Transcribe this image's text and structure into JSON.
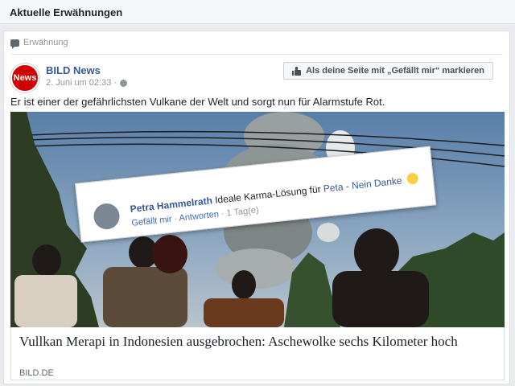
{
  "section": {
    "title": "Aktuelle Erwähnungen"
  },
  "post": {
    "mention_label": "Erwähnung",
    "page_name": "BILD News",
    "avatar_text": "News",
    "timestamp": "2. Juni um 02:33 ·",
    "like_button_label": "Als deine Seite mit „Gefällt mir“ markieren",
    "text": "Er ist einer der gefährlichsten Vulkane der Welt und sorgt nun für Alarmstufe Rot."
  },
  "comment": {
    "author": "Petra Hammelrath",
    "text": "Ideale Karma-Lösung für",
    "link_word": "Peta - Nein Danke",
    "actions": {
      "like": "Gefällt mir",
      "sep": "·",
      "reply": "Antworten",
      "time": "1 Tag(e)"
    }
  },
  "link_preview": {
    "headline": "Vullkan Merapi in Indonesien ausgebrochen: Aschewolke sechs Kilometer hoch",
    "domain": "BILD.DE"
  },
  "colors": {
    "link": "#365899",
    "brand_red": "#d00000",
    "background": "#e9ebee"
  },
  "icons": {
    "mention": "speech-bubble-icon",
    "privacy": "globe-icon",
    "like": "thumbs-up-icon",
    "emoji": "smiley-icon"
  }
}
